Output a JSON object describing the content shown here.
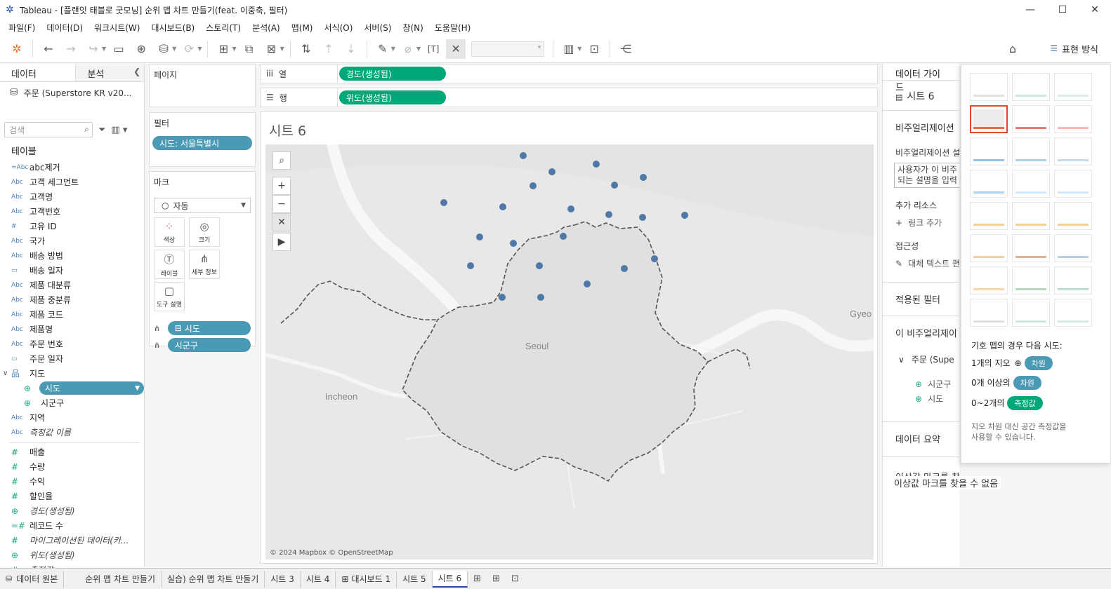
{
  "window": {
    "title": "Tableau - [플랜잇 태블로 굿모닝] 순위 맵 차트 만들기(feat. 이중축, 필터)",
    "app_icon": "tableau-icon",
    "controls": [
      "minimize-icon",
      "maximize-icon",
      "close-icon"
    ]
  },
  "menu": [
    "파일(F)",
    "데이터(D)",
    "워크시트(W)",
    "대시보드(B)",
    "스토리(T)",
    "분석(A)",
    "맵(M)",
    "서식(O)",
    "서버(S)",
    "창(N)",
    "도움말(H)"
  ],
  "toolbar": {
    "show_me_label": "표현 방식"
  },
  "datapane": {
    "tab_data": "데이터",
    "tab_analysis": "분석",
    "datasource": "주문 (Superstore KR v20...",
    "search_placeholder": "검색",
    "tables_header": "테이블",
    "fields": [
      {
        "type": "=Abc",
        "name": "abc제거",
        "italic": false
      },
      {
        "type": "Abc",
        "name": "고객 세그먼트",
        "italic": false
      },
      {
        "type": "Abc",
        "name": "고객명",
        "italic": false
      },
      {
        "type": "Abc",
        "name": "고객번호",
        "italic": false
      },
      {
        "type": "#",
        "name": "고유 ID",
        "italic": false
      },
      {
        "type": "Abc",
        "name": "국가",
        "italic": false
      },
      {
        "type": "Abc",
        "name": "배송 방법",
        "italic": false
      },
      {
        "type": "cal",
        "name": "배송 일자",
        "italic": false
      },
      {
        "type": "Abc",
        "name": "제품 대분류",
        "italic": false
      },
      {
        "type": "Abc",
        "name": "제품 중분류",
        "italic": false
      },
      {
        "type": "Abc",
        "name": "제품 코드",
        "italic": false
      },
      {
        "type": "Abc",
        "name": "제품명",
        "italic": false
      },
      {
        "type": "Abc",
        "name": "주문 번호",
        "italic": false
      },
      {
        "type": "cal",
        "name": "주문 일자",
        "italic": false
      }
    ],
    "geo_folder": "지도",
    "geo_children": [
      "시도",
      "시군구"
    ],
    "fields2": [
      {
        "type": "Abc",
        "name": "지역",
        "italic": false
      },
      {
        "type": "Abc",
        "name": "측정값 이름",
        "italic": true
      }
    ],
    "measures": [
      {
        "type": "#",
        "name": "매출",
        "italic": false
      },
      {
        "type": "#",
        "name": "수량",
        "italic": false
      },
      {
        "type": "#",
        "name": "수익",
        "italic": false
      },
      {
        "type": "#",
        "name": "할인율",
        "italic": false
      },
      {
        "type": "geo",
        "name": "경도(생성됨)",
        "italic": true
      },
      {
        "type": "=#",
        "name": "레코드 수",
        "italic": false
      },
      {
        "type": "#",
        "name": "마이그레이션된 데이터(카...",
        "italic": true
      },
      {
        "type": "geo",
        "name": "위도(생성됨)",
        "italic": true
      },
      {
        "type": "#",
        "name": "측정값",
        "italic": true
      }
    ]
  },
  "shelves": {
    "pages": "페이지",
    "filters": "필터",
    "filter_pill": "시도: 서울특별시",
    "marks": "마크",
    "marks_type": "자동",
    "mark_buttons": [
      "색상",
      "크기",
      "레이블",
      "세부 정보",
      "도구 설명"
    ],
    "mark_fields": [
      "시도",
      "시군구"
    ],
    "columns_label": "열",
    "rows_label": "행",
    "columns_pill": "경도(생성됨)",
    "rows_pill": "위도(생성됨)"
  },
  "viz": {
    "sheet_title": "시트 6",
    "map_labels": [
      "Seoul",
      "Incheon",
      "Gyeo"
    ],
    "attribution": "© 2024 Mapbox © OpenStreetMap",
    "point_color": "#4e79a7"
  },
  "guide": {
    "header": "데이터 가이드",
    "sheet": "시트 6",
    "viz_desc": "비주얼리제이션",
    "viz_desc2": "비주얼리제이션 설",
    "desc_placeholder_1": "사용자가 이 비주",
    "desc_placeholder_2": "되는 설명을 입력",
    "extra_resources": "추가 리소스",
    "add_link": "링크 추가",
    "accessibility": "접근성",
    "alt_text": "대체 텍스트 편",
    "applied_filters": "적용된 필터",
    "this_viz": "이 비주얼리제이",
    "source": "주문 (Supe",
    "src_fields": [
      "시군구",
      "시도"
    ],
    "data_summary": "데이터 요약",
    "no_outliers": "이상값 마크를 찾을 수 없음"
  },
  "showme": {
    "intro": "기호 맵의 경우 다음 시도:",
    "row1_label": "1개의 지오",
    "row1_chip": "차원",
    "row2_label": "0개 이상의",
    "row2_chip": "차원",
    "row3_label": "0~2개의",
    "row3_chip": "측정값",
    "note_1": "지오 차원 대신 공간 측정값을",
    "note_2": "사용할 수 있습니다."
  },
  "sheet_tabs": [
    "데이터 원본",
    "순위 맵 차트 만들기",
    "실습) 순위 맵 차트 만들기",
    "시트 3",
    "시트 4",
    "대시보드 1",
    "시트 5",
    "시트 6"
  ],
  "active_tab": "시트 6"
}
